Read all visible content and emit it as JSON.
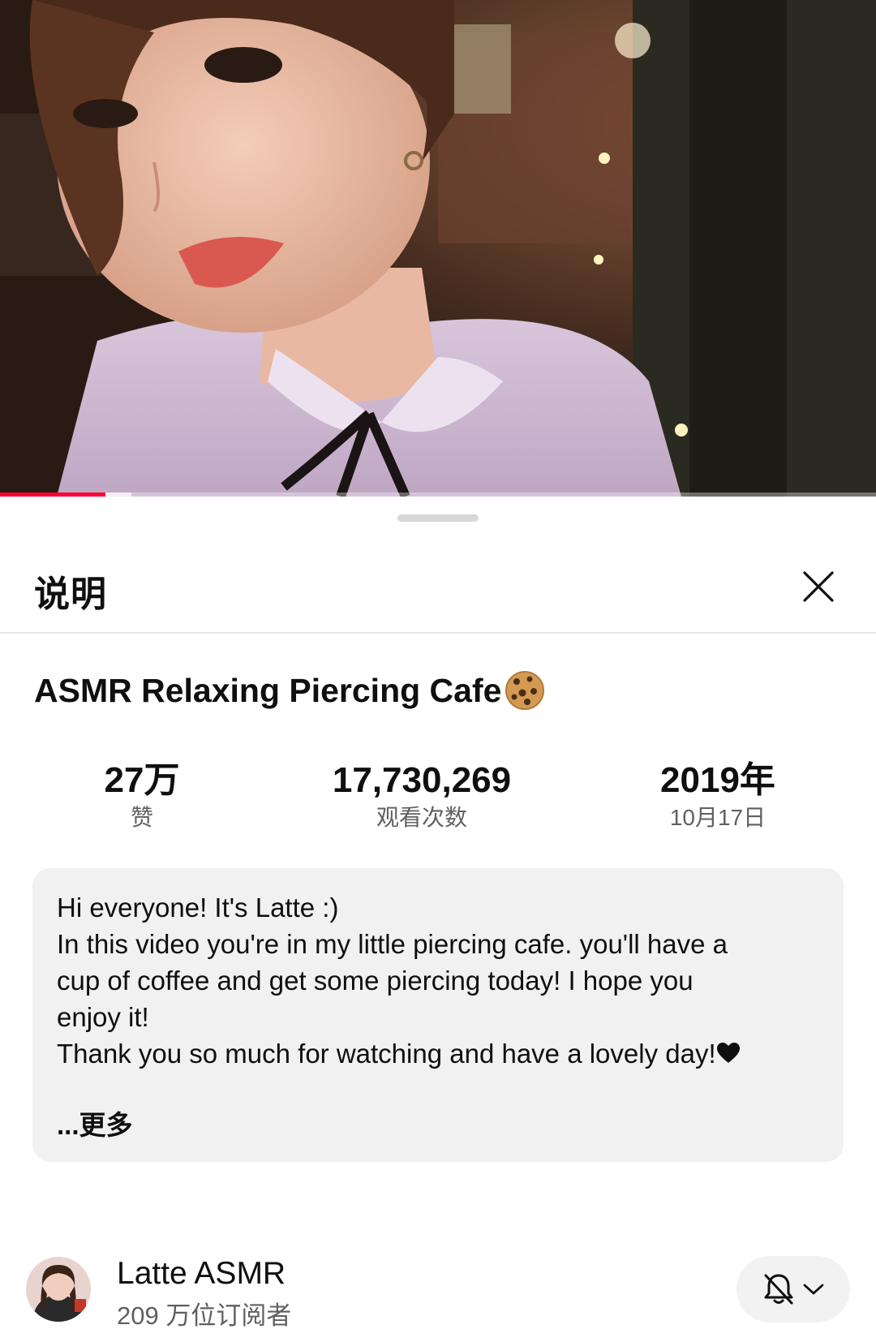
{
  "sheet": {
    "title": "说明"
  },
  "video": {
    "title": "ASMR Relaxing Piercing Cafe",
    "title_emoji_icon": "cookie-icon",
    "playback_progress_percent": 12,
    "buffered_percent": 15
  },
  "stats": {
    "likes": {
      "value": "27万",
      "label": "赞"
    },
    "views": {
      "value": "17,730,269",
      "label": "观看次数"
    },
    "date": {
      "year": "2019年",
      "day": "10月17日"
    }
  },
  "description": {
    "lines": [
      "Hi everyone! It's Latte :)",
      "In this video you're in my little piercing cafe. you'll have a",
      "cup of coffee and get some piercing today! I hope you",
      "enjoy it!",
      "Thank you so much for watching and have a lovely day!"
    ],
    "end_icon": "heart-icon",
    "more_label": "...更多"
  },
  "channel": {
    "name": "Latte ASMR",
    "subscribers": "209 万位订阅者",
    "notification_icon": "bell-off-icon",
    "dropdown_icon": "chevron-down-icon"
  },
  "colors": {
    "accent": "#ff0033",
    "panel_bg": "#f1f1f1",
    "secondary_text": "#606060"
  }
}
